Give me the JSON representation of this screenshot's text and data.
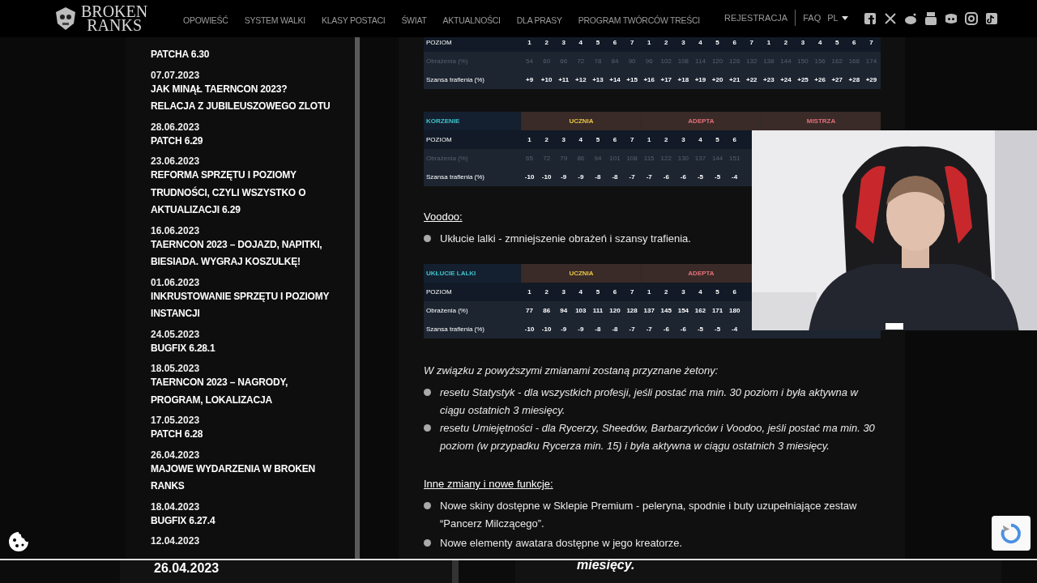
{
  "header": {
    "logo": [
      "BROKEN",
      "RANKS"
    ],
    "nav": [
      "OPOWIEŚĆ",
      "SYSTEM WALKI",
      "KLASY POSTACI",
      "ŚWIAT",
      "AKTUALNOŚCI",
      "DLA PRASY",
      "PROGRAM TWÓRCÓW TREŚCI"
    ],
    "account": [
      "REJESTRACJA",
      "FAQ"
    ],
    "language": "PL"
  },
  "sidebar": {
    "items": [
      {
        "title": "PATCHA 6.30"
      },
      {
        "date": "07.07.2023",
        "title": "JAK MINĄŁ TAERNCON 2023? RELACJA Z JUBILEUSZOWEGO ZLOTU"
      },
      {
        "date": "28.06.2023",
        "title": "PATCH 6.29"
      },
      {
        "date": "23.06.2023",
        "title": "REFORMA SPRZĘTU I POZIOMY TRUDNOŚCI, CZYLI WSZYSTKO O AKTUALIZACJI 6.29"
      },
      {
        "date": "16.06.2023",
        "title": "TAERNCON 2023 – DOJAZD, NAPITKI, BIESIADA. WYGRAJ KOSZULKĘ!"
      },
      {
        "date": "01.06.2023",
        "title": "INKRUSTOWANIE SPRZĘTU I POZIOMY INSTANCJI"
      },
      {
        "date": "24.05.2023",
        "title": "BUGFIX 6.28.1"
      },
      {
        "date": "18.05.2023",
        "title": "TAERNCON 2023 – NAGRODY, PROGRAM, LOKALIZACJA"
      },
      {
        "date": "17.05.2023",
        "title": "PATCH 6.28"
      },
      {
        "date": "26.04.2023",
        "title": "MAJOWE WYDARZENIA W BROKEN RANKS"
      },
      {
        "date": "18.04.2023",
        "title": "BUGFIX 6.27.4"
      },
      {
        "date": "12.04.2023"
      }
    ]
  },
  "article": {
    "blocks": [
      {
        "kind": "table",
        "rows": [
          {
            "label": "POZIOM",
            "dimmed": false,
            "values": [
              "1",
              "2",
              "3",
              "4",
              "5",
              "6",
              "7",
              "1",
              "2",
              "3",
              "4",
              "5",
              "6",
              "7",
              "1",
              "2",
              "3",
              "4",
              "5",
              "6",
              "7"
            ]
          },
          {
            "label": "Obrażenia (%)",
            "dimmed": true,
            "values": [
              "54",
              "60",
              "66",
              "72",
              "78",
              "84",
              "90",
              "96",
              "102",
              "108",
              "114",
              "120",
              "126",
              "132",
              "138",
              "144",
              "150",
              "156",
              "162",
              "168",
              "174"
            ]
          },
          {
            "label": "Szansa trafienia (%)",
            "dimmed": false,
            "values": [
              "+9",
              "+10",
              "+11",
              "+12",
              "+13",
              "+14",
              "+15",
              "+16",
              "+17",
              "+18",
              "+19",
              "+20",
              "+21",
              "+22",
              "+23",
              "+24",
              "+25",
              "+26",
              "+27",
              "+28",
              "+29"
            ]
          }
        ]
      },
      {
        "kind": "table",
        "title": "KORZENIE",
        "groups": [
          {
            "label": "UCZNIA",
            "color": "#e8c547"
          },
          {
            "label": "ADEPTA",
            "color": "#e0707a"
          },
          {
            "label": "MISTRZA",
            "color": "#e0707a"
          }
        ],
        "rows": [
          {
            "label": "POZIOM",
            "dimmed": false,
            "values": [
              "1",
              "2",
              "3",
              "4",
              "5",
              "6",
              "7",
              "1",
              "2",
              "3",
              "4",
              "5",
              "6"
            ]
          },
          {
            "label": "Obrażenia (%)",
            "dimmed": true,
            "values": [
              "65",
              "72",
              "79",
              "86",
              "94",
              "101",
              "108",
              "115",
              "122",
              "130",
              "137",
              "144",
              "151"
            ]
          },
          {
            "label": "Szansa trafienia (%)",
            "dimmed": false,
            "values": [
              "-10",
              "-10",
              "-9",
              "-9",
              "-8",
              "-8",
              "-7",
              "-7",
              "-6",
              "-6",
              "-5",
              "-5",
              "-4"
            ]
          }
        ]
      },
      {
        "kind": "heading",
        "text": "Voodoo:"
      },
      {
        "kind": "bullets",
        "italic": false,
        "items": [
          "Ukłucie lalki - zmniejszenie obrażeń i szansy trafienia."
        ]
      },
      {
        "kind": "table",
        "title": "UKŁUCIE LALKI",
        "groups": [
          {
            "label": "UCZNIA",
            "color": "#e8c547"
          },
          {
            "label": "ADEPTA",
            "color": "#e0707a"
          }
        ],
        "rows": [
          {
            "label": "POZIOM",
            "dimmed": false,
            "values": [
              "1",
              "2",
              "3",
              "4",
              "5",
              "6",
              "7",
              "1",
              "2",
              "3",
              "4",
              "5",
              "6"
            ]
          },
          {
            "label": "Obrażenia (%)",
            "dimmed": false,
            "values": [
              "77",
              "86",
              "94",
              "103",
              "111",
              "120",
              "128",
              "137",
              "145",
              "154",
              "162",
              "171",
              "180"
            ]
          },
          {
            "label": "Szansa trafienia (%)",
            "dimmed": false,
            "values": [
              "-10",
              "-10",
              "-9",
              "-9",
              "-8",
              "-8",
              "-7",
              "-7",
              "-6",
              "-6",
              "-5",
              "-5",
              "-4"
            ]
          }
        ]
      },
      {
        "kind": "paragraph",
        "italic": true,
        "text": "W związku z powyższymi zmianami zostaną przyznane żetony:"
      },
      {
        "kind": "bullets",
        "italic": true,
        "items": [
          "resetu Statystyk - dla wszystkich profesji, jeśli postać ma min. 30 poziom i była aktywna w ciągu ostatnich 3 miesięcy.",
          "resetu Umiejętności - dla Rycerzy, Sheedów, Barbarzyńców i Voodoo, jeśli postać ma min. 30 poziom (w przypadku Rycerza min. 15) i była aktywna w ciągu ostatnich 3 miesięcy."
        ]
      },
      {
        "kind": "heading",
        "text": "Inne zmiany i nowe funkcje:"
      },
      {
        "kind": "bullets",
        "italic": false,
        "items": [
          "Nowe skiny dostępne w Sklepie Premium - peleryna, spodnie i buty uzupełniające zestaw “Pancerz Milczącego”.",
          "Nowe elementy awatara dostępne w jego kreatorze."
        ]
      }
    ]
  },
  "stream_strip": {
    "date": "26.04.2023",
    "text": "miesięcy."
  }
}
